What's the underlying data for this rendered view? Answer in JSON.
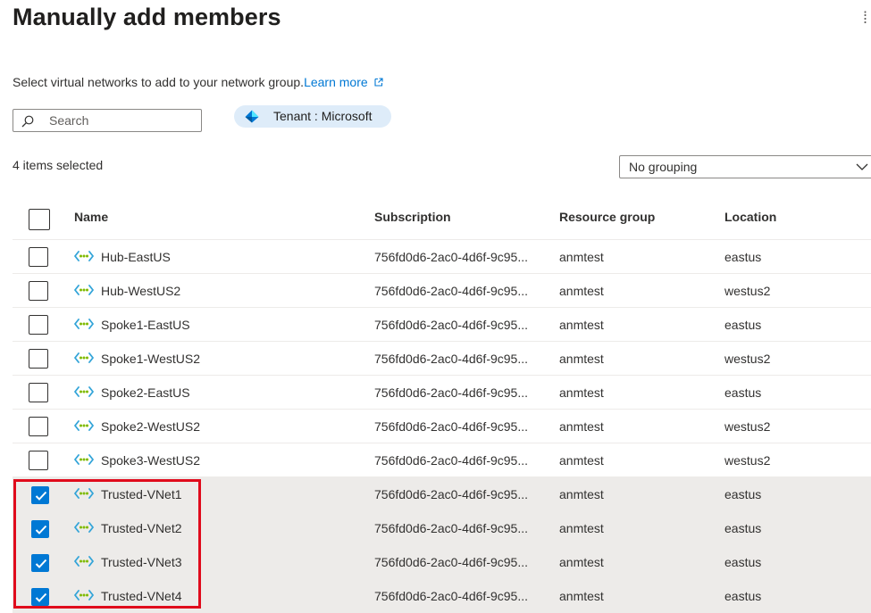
{
  "panel": {
    "title": "Manually add members",
    "description": "Select virtual networks to add to your network group.",
    "learn_more": "Learn more"
  },
  "search": {
    "placeholder": "Search",
    "value": ""
  },
  "filter": {
    "label": "Tenant : Microsoft"
  },
  "selection": {
    "count_label": "4 items selected"
  },
  "grouping": {
    "selected": "No grouping"
  },
  "table": {
    "columns": [
      "Name",
      "Subscription",
      "Resource group",
      "Location"
    ],
    "rows": [
      {
        "name": "Hub-EastUS",
        "subscription": "756fd0d6-2ac0-4d6f-9c95...",
        "resource_group": "anmtest",
        "location": "eastus",
        "selected": false
      },
      {
        "name": "Hub-WestUS2",
        "subscription": "756fd0d6-2ac0-4d6f-9c95...",
        "resource_group": "anmtest",
        "location": "westus2",
        "selected": false
      },
      {
        "name": "Spoke1-EastUS",
        "subscription": "756fd0d6-2ac0-4d6f-9c95...",
        "resource_group": "anmtest",
        "location": "eastus",
        "selected": false
      },
      {
        "name": "Spoke1-WestUS2",
        "subscription": "756fd0d6-2ac0-4d6f-9c95...",
        "resource_group": "anmtest",
        "location": "westus2",
        "selected": false
      },
      {
        "name": "Spoke2-EastUS",
        "subscription": "756fd0d6-2ac0-4d6f-9c95...",
        "resource_group": "anmtest",
        "location": "eastus",
        "selected": false
      },
      {
        "name": "Spoke2-WestUS2",
        "subscription": "756fd0d6-2ac0-4d6f-9c95...",
        "resource_group": "anmtest",
        "location": "westus2",
        "selected": false
      },
      {
        "name": "Spoke3-WestUS2",
        "subscription": "756fd0d6-2ac0-4d6f-9c95...",
        "resource_group": "anmtest",
        "location": "westus2",
        "selected": false
      },
      {
        "name": "Trusted-VNet1",
        "subscription": "756fd0d6-2ac0-4d6f-9c95...",
        "resource_group": "anmtest",
        "location": "eastus",
        "selected": true
      },
      {
        "name": "Trusted-VNet2",
        "subscription": "756fd0d6-2ac0-4d6f-9c95...",
        "resource_group": "anmtest",
        "location": "eastus",
        "selected": true
      },
      {
        "name": "Trusted-VNet3",
        "subscription": "756fd0d6-2ac0-4d6f-9c95...",
        "resource_group": "anmtest",
        "location": "eastus",
        "selected": true
      },
      {
        "name": "Trusted-VNet4",
        "subscription": "756fd0d6-2ac0-4d6f-9c95...",
        "resource_group": "anmtest",
        "location": "eastus",
        "selected": true
      }
    ]
  },
  "icons": {
    "row_icon": "virtual-network-icon",
    "filter_icon": "tenant-icon",
    "search_icon": "search-icon",
    "link_icon": "open-in-new-icon",
    "dropdown_icon": "chevron-down-icon"
  },
  "colors": {
    "accent": "#0078d4",
    "selected_row": "#edebe9",
    "filter_pill": "#deecf9",
    "highlight_box": "#e00b1c"
  }
}
